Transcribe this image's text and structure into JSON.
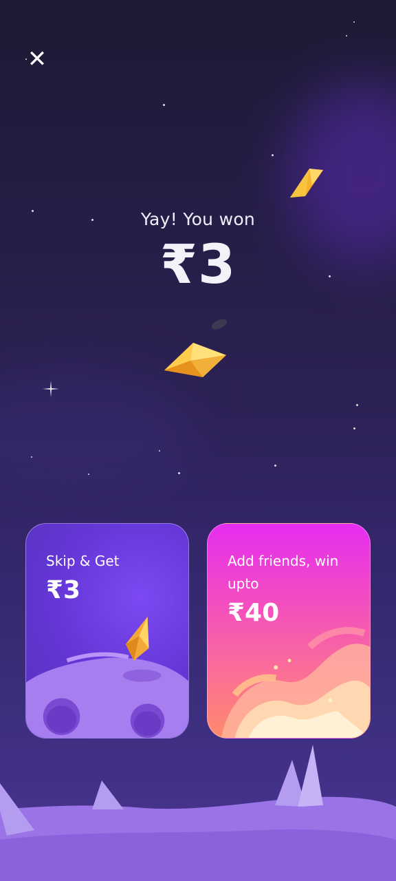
{
  "close_button": {
    "icon": "close-icon",
    "glyph": "✕"
  },
  "result": {
    "title": "Yay! You won",
    "amount": "₹3"
  },
  "cards": {
    "skip": {
      "label": "Skip & Get",
      "amount": "₹3"
    },
    "friends": {
      "label": "Add friends, win upto",
      "amount": "₹40"
    }
  },
  "colors": {
    "gem": "#f5b028",
    "skip_card": "#6a3be0",
    "friends_card_top": "#e52df1",
    "friends_card_bottom": "#fe8a6b"
  }
}
